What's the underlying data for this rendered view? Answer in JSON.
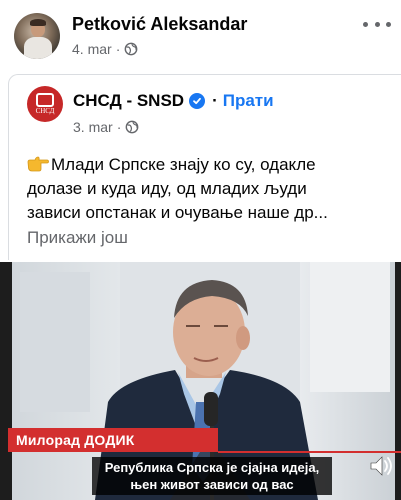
{
  "outer_post": {
    "author": "Petković Aleksandar",
    "date": "4. mar",
    "separator": "·"
  },
  "shared_post": {
    "page_name": "СНСД - SNSD",
    "separator": "·",
    "follow_label": "Прати",
    "date": "3. mar",
    "logo_text": "СНСД",
    "text_lines": [
      "Млади Српске знају ко су, одакле",
      "долазе и куда иду, од младих људи",
      "зависи опстанак и очување наше др..."
    ],
    "see_more": "Прикажи још"
  },
  "video": {
    "name_tag": "Милорад ДОДИК",
    "subtitle_lines": [
      "Република Српска је сјајна идеја,",
      "њен живот зависи од вас"
    ]
  },
  "icons": {
    "globe": "globe-icon",
    "verified": "verified-badge-icon",
    "more": "more-options-icon",
    "pointing": "pointing-right-emoji",
    "mute": "speaker-muted-icon"
  },
  "colors": {
    "accent": "#1877f2",
    "secondary_text": "#65676b",
    "lower_third": "#d32f2f",
    "logo": "#c62828"
  }
}
